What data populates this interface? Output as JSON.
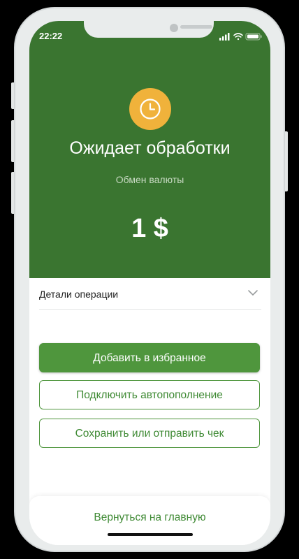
{
  "status_bar": {
    "time": "22:22",
    "icons": [
      "signal-icon",
      "wifi-icon",
      "battery-icon"
    ]
  },
  "header": {
    "status_title": "Ожидает обработки",
    "operation_type": "Обмен валюты",
    "amount": "1 $",
    "icon": "clock-icon"
  },
  "details": {
    "label": "Детали операции",
    "icon": "chevron-down-icon"
  },
  "actions": {
    "add_favorite": "Добавить в избранное",
    "autopay": "Подключить автопополнение",
    "save_receipt": "Сохранить или отправить чек"
  },
  "footer": {
    "home_link": "Вернуться на главную"
  },
  "colors": {
    "header_bg": "#3a7530",
    "accent": "#4f963d",
    "clock_badge": "#f0b23b",
    "link_text": "#3f8a34"
  }
}
